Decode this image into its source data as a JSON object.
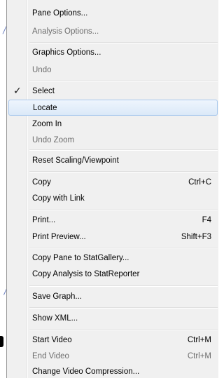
{
  "menu": {
    "items": [
      {
        "label": "Pane Options...",
        "shortcut": "",
        "disabled": false
      },
      {
        "label": "Analysis Options...",
        "shortcut": "",
        "disabled": true
      },
      {
        "label": "Graphics Options...",
        "shortcut": "",
        "disabled": false
      },
      {
        "label": "Undo",
        "shortcut": "",
        "disabled": true
      },
      {
        "label": "Select",
        "shortcut": "",
        "disabled": false,
        "checked": true
      },
      {
        "label": "Locate",
        "shortcut": "",
        "disabled": false,
        "highlighted": true
      },
      {
        "label": "Zoom In",
        "shortcut": "",
        "disabled": false
      },
      {
        "label": "Undo Zoom",
        "shortcut": "",
        "disabled": true
      },
      {
        "label": "Reset Scaling/Viewpoint",
        "shortcut": "",
        "disabled": false
      },
      {
        "label": "Copy",
        "shortcut": "Ctrl+C",
        "disabled": false
      },
      {
        "label": "Copy with Link",
        "shortcut": "",
        "disabled": false
      },
      {
        "label": "Print...",
        "shortcut": "F4",
        "disabled": false
      },
      {
        "label": "Print Preview...",
        "shortcut": "Shift+F3",
        "disabled": false
      },
      {
        "label": "Copy Pane to StatGallery...",
        "shortcut": "",
        "disabled": false
      },
      {
        "label": "Copy Analysis to StatReporter",
        "shortcut": "",
        "disabled": false
      },
      {
        "label": "Save Graph...",
        "shortcut": "",
        "disabled": false
      },
      {
        "label": "Show XML...",
        "shortcut": "",
        "disabled": false
      },
      {
        "label": "Start Video",
        "shortcut": "Ctrl+M",
        "disabled": false
      },
      {
        "label": "End Video",
        "shortcut": "Ctrl+M",
        "disabled": true
      },
      {
        "label": "Change Video Compression...",
        "shortcut": "",
        "disabled": false
      }
    ],
    "check_glyph": "✓"
  },
  "colors": {
    "menu_background": "#f0f0f0",
    "disabled_text": "#6d6d6d",
    "hover_border": "#a8c8ee"
  }
}
